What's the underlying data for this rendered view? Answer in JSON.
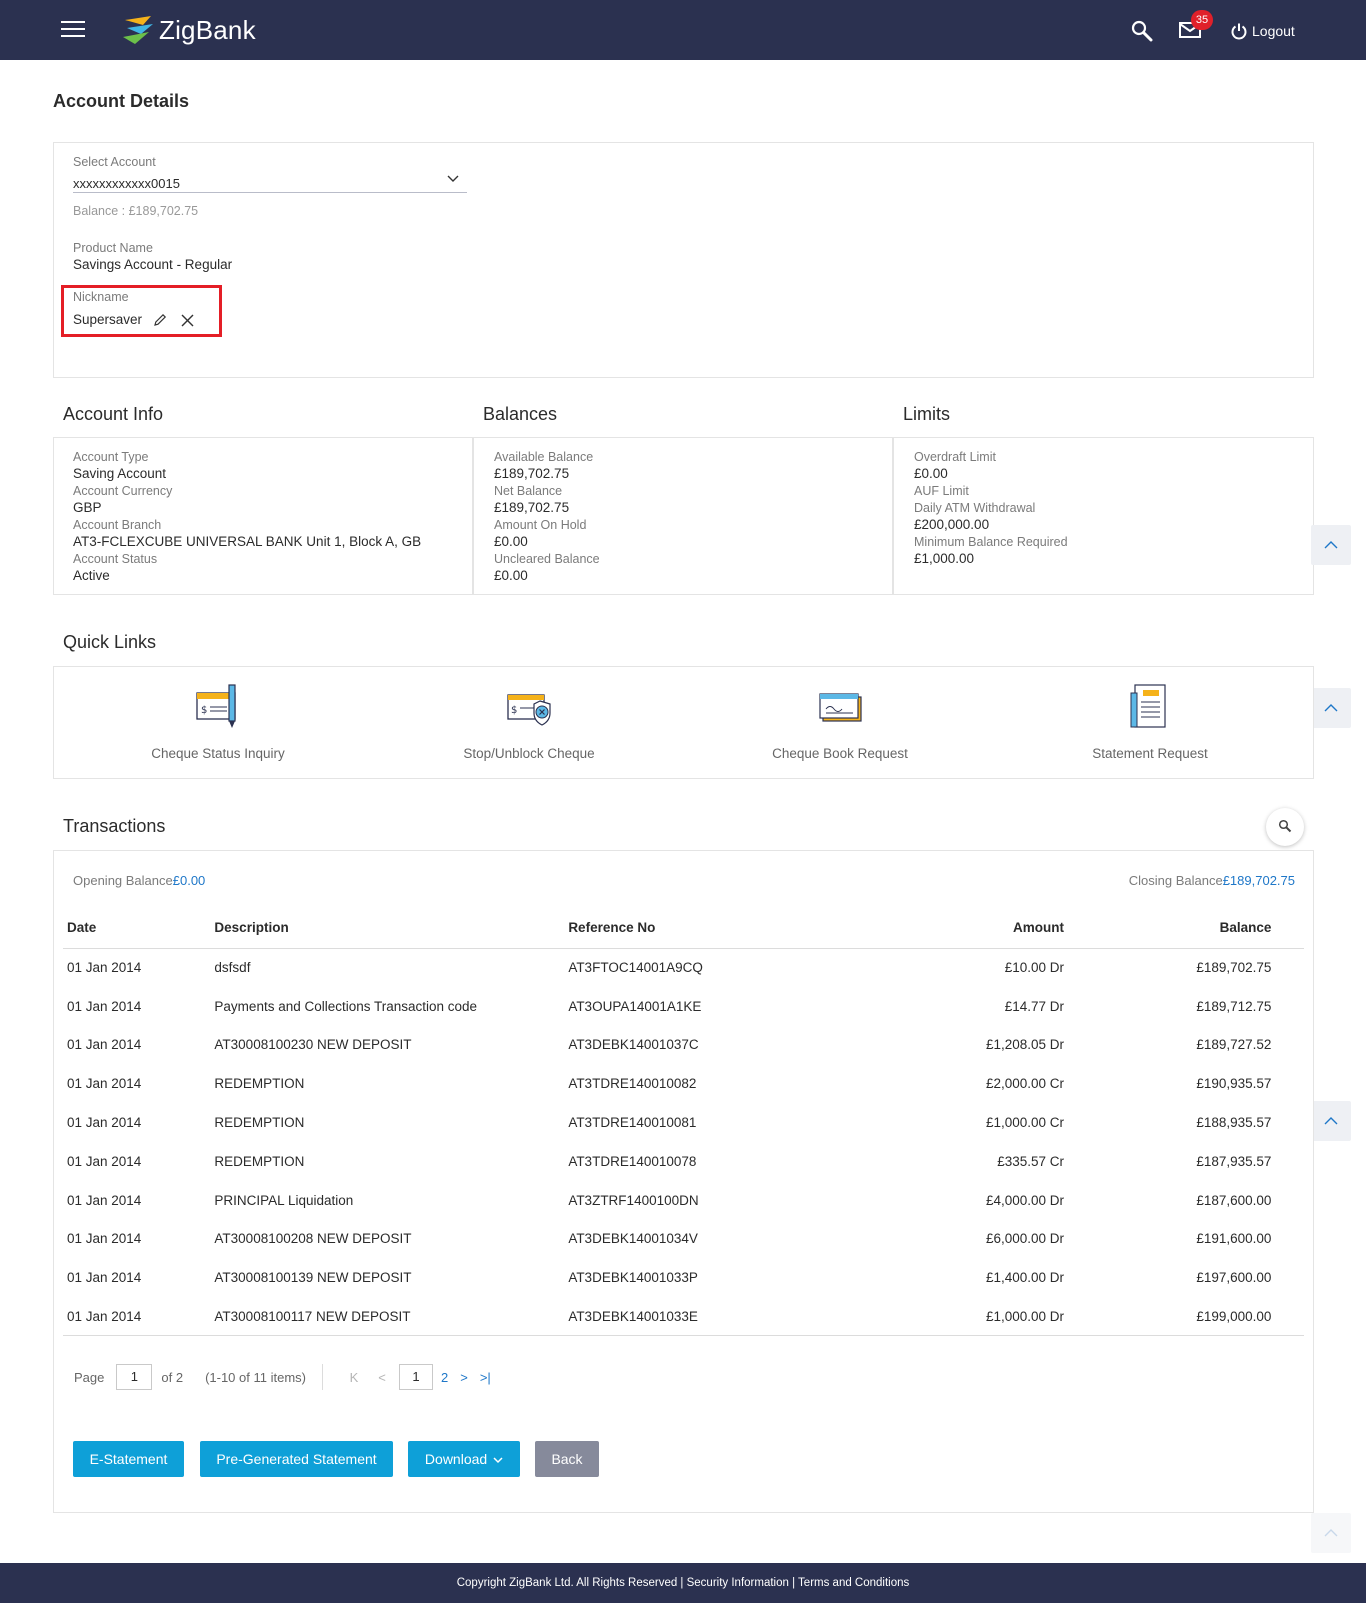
{
  "header": {
    "brand": "ZigBank",
    "mail_count": "35",
    "logout_label": "Logout"
  },
  "page": {
    "title": "Account Details"
  },
  "account": {
    "select_label": "Select Account",
    "selected_account": "xxxxxxxxxxxx0015",
    "balance_text": "Balance : £189,702.75",
    "product_label": "Product Name",
    "product_value": "Savings Account - Regular",
    "nickname_label": "Nickname",
    "nickname_value": "Supersaver"
  },
  "account_info": {
    "title": "Account Info",
    "items": [
      {
        "label": "Account Type",
        "value": "Saving Account"
      },
      {
        "label": "Account Currency",
        "value": "GBP"
      },
      {
        "label": "Account Branch",
        "value": "AT3-FCLEXCUBE UNIVERSAL BANK Unit 1, Block A, GB"
      },
      {
        "label": "Account Status",
        "value": "Active"
      }
    ]
  },
  "balances": {
    "title": "Balances",
    "items": [
      {
        "label": "Available Balance",
        "value": "£189,702.75"
      },
      {
        "label": "Net Balance",
        "value": "£189,702.75"
      },
      {
        "label": "Amount On Hold",
        "value": "£0.00"
      },
      {
        "label": "Uncleared Balance",
        "value": "£0.00"
      }
    ]
  },
  "limits": {
    "title": "Limits",
    "items": [
      {
        "label": "Overdraft Limit",
        "value": "£0.00"
      },
      {
        "label": "AUF Limit",
        "value": ""
      },
      {
        "label": "Daily ATM Withdrawal",
        "value": "£200,000.00"
      },
      {
        "label": "Minimum Balance Required",
        "value": "£1,000.00"
      }
    ]
  },
  "quick_links": {
    "title": "Quick Links",
    "items": [
      {
        "label": "Cheque Status Inquiry",
        "icon": "cheque-status-icon"
      },
      {
        "label": "Stop/Unblock Cheque",
        "icon": "stop-cheque-icon"
      },
      {
        "label": "Cheque Book Request",
        "icon": "cheque-book-icon"
      },
      {
        "label": "Statement Request",
        "icon": "statement-icon"
      }
    ]
  },
  "transactions": {
    "title": "Transactions",
    "opening_label": "Opening Balance",
    "opening_value": "£0.00",
    "closing_label": "Closing Balance",
    "closing_value": "£189,702.75",
    "columns": [
      "Date",
      "Description",
      "Reference No",
      "Amount",
      "Balance"
    ],
    "rows": [
      [
        "01 Jan 2014",
        "dsfsdf",
        "AT3FTOC14001A9CQ",
        "£10.00 Dr",
        "£189,702.75"
      ],
      [
        "01 Jan 2014",
        "Payments and Collections Transaction code",
        "AT3OUPA14001A1KE",
        "£14.77 Dr",
        "£189,712.75"
      ],
      [
        "01 Jan 2014",
        "AT30008100230 NEW DEPOSIT",
        "AT3DEBK14001037C",
        "£1,208.05 Dr",
        "£189,727.52"
      ],
      [
        "01 Jan 2014",
        "REDEMPTION",
        "AT3TDRE140010082",
        "£2,000.00 Cr",
        "£190,935.57"
      ],
      [
        "01 Jan 2014",
        "REDEMPTION",
        "AT3TDRE140010081",
        "£1,000.00 Cr",
        "£188,935.57"
      ],
      [
        "01 Jan 2014",
        "REDEMPTION",
        "AT3TDRE140010078",
        "£335.57 Cr",
        "£187,935.57"
      ],
      [
        "01 Jan 2014",
        "PRINCIPAL Liquidation",
        "AT3ZTRF1400100DN",
        "£4,000.00 Dr",
        "£187,600.00"
      ],
      [
        "01 Jan 2014",
        "AT30008100208 NEW DEPOSIT",
        "AT3DEBK14001034V",
        "£6,000.00 Dr",
        "£191,600.00"
      ],
      [
        "01 Jan 2014",
        "AT30008100139 NEW DEPOSIT",
        "AT3DEBK14001033P",
        "£1,400.00 Dr",
        "£197,600.00"
      ],
      [
        "01 Jan 2014",
        "AT30008100117 NEW DEPOSIT",
        "AT3DEBK14001033E",
        "£1,000.00 Dr",
        "£199,000.00"
      ]
    ]
  },
  "pagination": {
    "page_label": "Page",
    "page_value": "1",
    "of_label": "of 2",
    "items_text": "(1-10 of 11 items)",
    "first": "K",
    "prev": "<",
    "current": "1",
    "next_page": "2",
    "next": ">",
    "last": ">|"
  },
  "actions": {
    "e_statement": "E-Statement",
    "pre_generated": "Pre-Generated Statement",
    "download": "Download",
    "back": "Back"
  },
  "footer": {
    "text": "Copyright ZigBank Ltd. All Rights Reserved | Security Information | Terms and Conditions"
  }
}
